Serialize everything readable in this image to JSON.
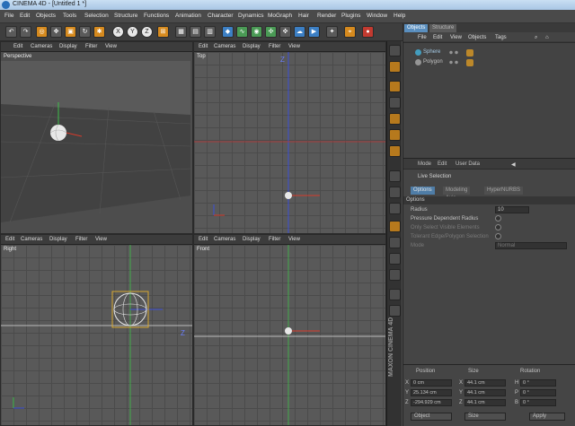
{
  "window": {
    "title": "CINEMA 4D - [Untitled 1 *]"
  },
  "menubar": [
    "File",
    "Edit",
    "Objects",
    "Tools",
    "Selection",
    "Structure",
    "Functions",
    "Animation",
    "Character",
    "Dynamics",
    "MoGraph",
    "Hair",
    "Render",
    "Plugins",
    "Window",
    "Help"
  ],
  "toolbar": {
    "axis_x": "X",
    "axis_y": "Y",
    "axis_z": "Z"
  },
  "viewports": {
    "menu": [
      "Edit",
      "Cameras",
      "Display",
      "Filter",
      "View"
    ],
    "perspective": {
      "label": "Perspective"
    },
    "top": {
      "label": "Top",
      "axis": "Z"
    },
    "right": {
      "label": "Right",
      "axis": "Z"
    },
    "front": {
      "label": "Front"
    }
  },
  "objects_panel": {
    "tabs": [
      "Objects",
      "Structure"
    ],
    "menu": [
      "File",
      "Edit",
      "View",
      "Objects",
      "Tags"
    ],
    "items": [
      "Sphere",
      "Polygon"
    ]
  },
  "attributes_panel": {
    "menu": [
      "Mode",
      "Edit",
      "User Data"
    ],
    "title": "Live Selection",
    "tabs": [
      "Options",
      "Modeling Axis",
      "HyperNURBS"
    ],
    "section": "Options",
    "radius_label": "Radius",
    "radius_value": "10",
    "options": [
      "Pressure Dependent Radius",
      "Only Select Visible Elements",
      "Tolerant Edge/Polygon Selection"
    ],
    "mode_label": "Mode",
    "mode_value": "Normal"
  },
  "coordinates": {
    "headers": [
      "Position",
      "Size",
      "Rotation"
    ],
    "rows": [
      {
        "axis": "X",
        "pos": "0 cm",
        "size_axis": "X",
        "size": "44.1 cm",
        "rot_axis": "H",
        "rot": "0 °"
      },
      {
        "axis": "Y",
        "pos": "25.134 cm",
        "size_axis": "Y",
        "size": "44.1 cm",
        "rot_axis": "P",
        "rot": "0 °"
      },
      {
        "axis": "Z",
        "pos": "-294.929 cm",
        "size_axis": "Z",
        "size": "44.1 cm",
        "rot_axis": "B",
        "rot": "0 °"
      }
    ],
    "dropdowns": [
      "Object",
      "Size"
    ],
    "apply": "Apply"
  },
  "brand": "MAXON CINEMA 4D",
  "colors": {
    "accent": "#d68a1e",
    "selection": "#5a8fbf",
    "axis_x": "#d83a2a",
    "axis_y": "#3fbf4a",
    "axis_z": "#3a4ed8"
  }
}
